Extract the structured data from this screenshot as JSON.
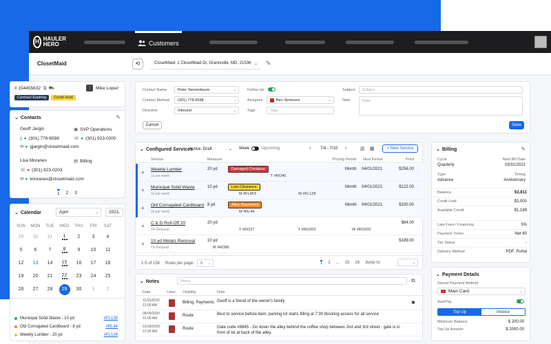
{
  "app": {
    "logo_line1": "HAULER",
    "logo_line2": "HERO",
    "nav_customers": "Customers"
  },
  "header": {
    "title": "ClosetMaid",
    "account_select": "ClosetMaid: 1 ClosetMaid Dr, Grantsville, MD, 21536"
  },
  "customer": {
    "id": "# 154455632",
    "owner": "Mike Lopez",
    "badges": [
      "Contract Expiring",
      "Credit Hold"
    ],
    "contacts_title": "Contacts",
    "contacts": [
      {
        "name": "Geoff Jargin",
        "role": "SVP Operations",
        "phone": "(301) 778-6598",
        "phone2": "(301) 923-0200",
        "email": "gjargin@closetmaid.com"
      },
      {
        "name": "Lisa Moranes",
        "role": "Billing",
        "phone": "(301) 923-0203",
        "email": "lmoranes@closetmaid.com"
      }
    ],
    "pages": [
      "1",
      "2",
      "3"
    ]
  },
  "calendar": {
    "title": "Calendar",
    "month": "April",
    "year": "2021",
    "weekdays": [
      "SUN",
      "MON",
      "TUE",
      "WED",
      "THU",
      "FRI",
      "SAT"
    ],
    "weeks": [
      [
        "29",
        "30",
        "31",
        "1",
        "2",
        "3",
        "4"
      ],
      [
        "5",
        "6",
        "7",
        "8",
        "9",
        "10",
        "11"
      ],
      [
        "12",
        "13",
        "14",
        "15",
        "16",
        "17",
        "18"
      ],
      [
        "19",
        "20",
        "21",
        "22",
        "23",
        "24",
        "25"
      ],
      [
        "26",
        "27",
        "28",
        "29",
        "30",
        "1",
        "2"
      ]
    ],
    "selected": "29",
    "events": [
      {
        "name": "Municipal Solid Waste - 10 yd",
        "code": "#FL128",
        "color": "#2aa05a"
      },
      {
        "name": "Old Corrugated Cardboard - 8 yd",
        "code": "#RL44",
        "color": "#e8862a"
      },
      {
        "name": "Weekly Lumber - 20 yd",
        "code": "#FL128",
        "color": "#e6c020"
      }
    ]
  },
  "activity": {
    "contact_name_label": "Contact Name",
    "contact_name": "Peter Tannenbaum",
    "contact_method_label": "Contact Method",
    "contact_method": "(301) 778-6598",
    "direction_label": "Direction",
    "direction": "Inbound",
    "followup_label": "Follow Up",
    "assignee_label": "Assignee",
    "assignee": "Ben Simmons",
    "tags_label": "Tags",
    "tags_placeholder": "Tags",
    "subject_label": "Subject",
    "subject_placeholder": "Subject",
    "note_label": "Note",
    "note_placeholder": "Note",
    "cancel": "Cancel",
    "save": "Save"
  },
  "services": {
    "title": "Configured Services",
    "filter": "Active, Draft",
    "week_label": "Week",
    "upcoming_label": "Upcoming",
    "range": "7/4 - 7/10",
    "new_service": "+ New Service",
    "columns": [
      "Service",
      "Measure",
      "Pricing Period",
      "Next Period",
      "Price"
    ],
    "rows": [
      {
        "name": "Weekly Lumber",
        "sub": "1x per week",
        "measure": "20 yd",
        "tag": "Damaged Container",
        "tag_color": "#d9363e",
        "tag_text": "#fff",
        "codes": [
          "T #RO45"
        ],
        "period": "Month",
        "next": "04/01/2021",
        "price": "$256.00"
      },
      {
        "name": "Municipal Solid Waste",
        "sub": "3x per week",
        "measure": "10 yd",
        "tag": "Low Clearance",
        "tag_color": "#f5d33b",
        "tag_text": "#222",
        "codes": [
          "M #FL453",
          "W #FL128"
        ],
        "period": "Month",
        "next": "04/01/2021",
        "price": "$122.00"
      },
      {
        "name": "Old Corrugated Cardboard",
        "sub": "2x per week",
        "measure": "8 yd",
        "tag": "Alley Placement",
        "tag_color": "#ef8a2b",
        "tag_text": "#fff",
        "codes": [
          "M #RL44"
        ],
        "period": "Month",
        "next": "04/01/2021",
        "price": "$100.00"
      },
      {
        "name": "C & D Roll-Off 20",
        "sub": "On Request",
        "measure": "20 yd",
        "tag": "",
        "codes": [
          "T #RO27",
          "T #RO203",
          "W #RO203"
        ],
        "period": "",
        "next": "",
        "price": "$64.00"
      },
      {
        "name": "10 yd Metals Removal",
        "sub": "On Request",
        "measure": "10 yd",
        "tag": "",
        "codes": [
          "M #RO88"
        ],
        "period": "",
        "next": "",
        "price": "$189.00"
      }
    ],
    "footer_count": "1-5 of 158",
    "rows_per_page_label": "Rows per page:",
    "rows_per_page": "5",
    "pages": [
      "1",
      "2",
      "...",
      "15",
      "16"
    ],
    "jump_label": "Jump to:"
  },
  "notes": {
    "title": "Notes",
    "placeholder": "Notes",
    "columns": [
      "Date",
      "User",
      "Visibility",
      "Note"
    ],
    "rows": [
      {
        "date": "11/15/2020",
        "time": "12:00 AM",
        "visibility": "Billing, Payments",
        "note": "Geoff is a friend of the owner's family"
      },
      {
        "date": "06/09/2020",
        "time": "12:00 AM",
        "visibility": "Route",
        "note": "Best to service before 6am, parking lot starts filling at 7:30 blocking access for all service"
      },
      {
        "date": "01/18/2020",
        "time": "12:00 AM",
        "visibility": "Route",
        "note": "Gate code #8845 - Go down the alley behind the coffee shop between 2nd and 3rd street - gate is in front of lot at back of the alley."
      }
    ]
  },
  "billing": {
    "title": "Billing",
    "cycle_label": "Cycle",
    "cycle": "Quarterly",
    "next_bill_label": "Next Bill Date",
    "next_bill": "03/31/2021",
    "type_label": "Type",
    "type": "Advance",
    "timing_label": "Timing",
    "timing": "Anniversary",
    "items": [
      {
        "label": "Balance",
        "value": "$3,811"
      },
      {
        "label": "Credit Limit",
        "value": "$3,000"
      },
      {
        "label": "Available Credit",
        "value": "$1,189"
      },
      {
        "label": "Late Fees / Financing",
        "value": "5%"
      },
      {
        "label": "Payment Terms",
        "value": "Net 60"
      },
      {
        "label": "Tax Status",
        "value": "-"
      },
      {
        "label": "Delivery Method",
        "value": "PDF, Portal"
      }
    ]
  },
  "payment": {
    "title": "Payment Details",
    "stored_label": "Stored Payment Method",
    "stored": "Main Card",
    "autopay_label": "AutoPay",
    "tabs": [
      "Top Up",
      "Invoice"
    ],
    "min_label": "Minimum Balance",
    "min": "$ 200.00",
    "topup_label": "Top Up Amount",
    "topup": "$ 2000.00"
  }
}
